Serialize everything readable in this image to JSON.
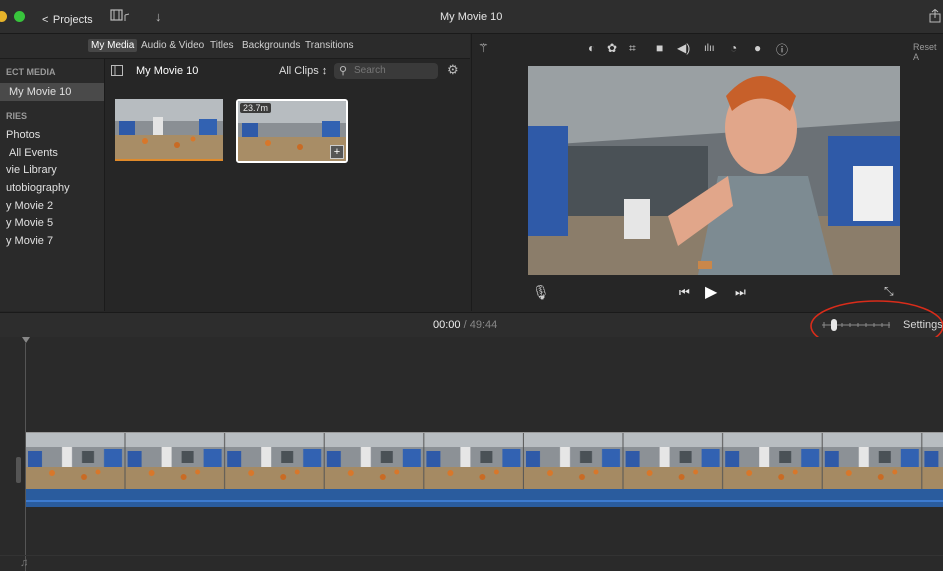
{
  "titlebar": {
    "projects_label": "Projects",
    "title": "My Movie 10"
  },
  "media_tabs": [
    "My Media",
    "Audio & Video",
    "Titles",
    "Backgrounds",
    "Transitions"
  ],
  "sidebar": {
    "section1": "ECT MEDIA",
    "project": "My Movie 10",
    "section2": "RIES",
    "items": [
      "Photos",
      "All Events",
      "vie Library",
      "utobiography",
      "y Movie 2",
      "y Movie 5",
      "y Movie 7"
    ]
  },
  "browser": {
    "event_title": "My Movie 10",
    "filter": "All Clips ↕",
    "search_placeholder": "Search",
    "clips": [
      {
        "duration": ""
      },
      {
        "duration": "23.7m"
      }
    ]
  },
  "viewer": {
    "reset_label": "Reset A"
  },
  "timeline": {
    "current_time": "00:00",
    "separator": "/",
    "total_time": "49:44",
    "settings_label": "Settings",
    "zoom_level": 0.15
  },
  "colors": {
    "annotation": "#d92c1a",
    "audio": "#2a5c9e",
    "clip_border": "#e08a2a"
  }
}
